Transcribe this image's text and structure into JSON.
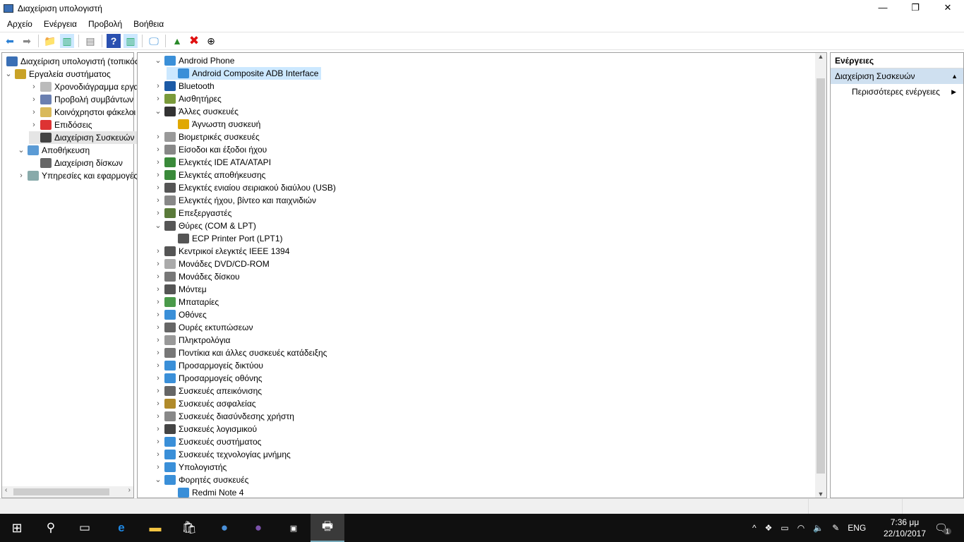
{
  "window": {
    "title": "Διαχείριση υπολογιστή",
    "minimize": "—",
    "maximize": "❐",
    "close": "✕"
  },
  "menu": [
    "Αρχείο",
    "Ενέργεια",
    "Προβολή",
    "Βοήθεια"
  ],
  "left_tree": [
    {
      "label": "Διαχείριση υπολογιστή (τοπικός)",
      "level": 0,
      "chev": "",
      "color": "#3a6fb5"
    },
    {
      "label": "Εργαλεία συστήματος",
      "level": 0,
      "chev": "⌄",
      "color": "#c9a227",
      "indent": 1
    },
    {
      "label": "Χρονοδιάγραμμα εργασιών",
      "level": 2,
      "chev": "›",
      "color": "#bbb"
    },
    {
      "label": "Προβολή συμβάντων",
      "level": 2,
      "chev": "›",
      "color": "#6a7fb0"
    },
    {
      "label": "Κοινόχρηστοι φάκελοι",
      "level": 2,
      "chev": "›",
      "color": "#d9b95a"
    },
    {
      "label": "Επιδόσεις",
      "level": 2,
      "chev": "›",
      "color": "#d33"
    },
    {
      "label": "Διαχείριση Συσκευών",
      "level": 2,
      "chev": "",
      "color": "#444",
      "selected": true
    },
    {
      "label": "Αποθήκευση",
      "level": 1,
      "chev": "⌄",
      "color": "#5b9bd5"
    },
    {
      "label": "Διαχείριση δίσκων",
      "level": 2,
      "chev": "",
      "color": "#666"
    },
    {
      "label": "Υπηρεσίες και εφαρμογές",
      "level": 1,
      "chev": "›",
      "color": "#8aa"
    }
  ],
  "devices": [
    {
      "label": "Android Phone",
      "level": 0,
      "chev": "⌄",
      "color": "#3a8fd8"
    },
    {
      "label": "Android Composite ADB Interface",
      "level": 1,
      "chev": "",
      "color": "#3a8fd8",
      "selected": true
    },
    {
      "label": "Bluetooth",
      "level": 0,
      "chev": "›",
      "color": "#1c5aa6"
    },
    {
      "label": "Αισθητήρες",
      "level": 0,
      "chev": "›",
      "color": "#7a9a3a"
    },
    {
      "label": "Άλλες συσκευές",
      "level": 0,
      "chev": "⌄",
      "color": "#333"
    },
    {
      "label": "Άγνωστη συσκευή",
      "level": 1,
      "chev": "",
      "color": "#e0a800"
    },
    {
      "label": "Βιομετρικές συσκευές",
      "level": 0,
      "chev": "›",
      "color": "#999"
    },
    {
      "label": "Είσοδοι και έξοδοι ήχου",
      "level": 0,
      "chev": "›",
      "color": "#888"
    },
    {
      "label": "Ελεγκτές IDE ATA/ATAPI",
      "level": 0,
      "chev": "›",
      "color": "#3a8a3a"
    },
    {
      "label": "Ελεγκτές αποθήκευσης",
      "level": 0,
      "chev": "›",
      "color": "#3a8a3a"
    },
    {
      "label": "Ελεγκτές ενιαίου σειριακού διαύλου (USB)",
      "level": 0,
      "chev": "›",
      "color": "#555"
    },
    {
      "label": "Ελεγκτές ήχου, βίντεο και παιχνιδιών",
      "level": 0,
      "chev": "›",
      "color": "#888"
    },
    {
      "label": "Επεξεργαστές",
      "level": 0,
      "chev": "›",
      "color": "#5a7a3a"
    },
    {
      "label": "Θύρες (COM & LPT)",
      "level": 0,
      "chev": "⌄",
      "color": "#555"
    },
    {
      "label": "ECP Printer Port (LPT1)",
      "level": 1,
      "chev": "",
      "color": "#555"
    },
    {
      "label": "Κεντρικοί ελεγκτές IEEE 1394",
      "level": 0,
      "chev": "›",
      "color": "#555"
    },
    {
      "label": "Μονάδες DVD/CD-ROM",
      "level": 0,
      "chev": "›",
      "color": "#aaa"
    },
    {
      "label": "Μονάδες δίσκου",
      "level": 0,
      "chev": "›",
      "color": "#777"
    },
    {
      "label": "Μόντεμ",
      "level": 0,
      "chev": "›",
      "color": "#555"
    },
    {
      "label": "Μπαταρίες",
      "level": 0,
      "chev": "›",
      "color": "#4a9a4a"
    },
    {
      "label": "Οθόνες",
      "level": 0,
      "chev": "›",
      "color": "#3a8fd8"
    },
    {
      "label": "Ουρές εκτυπώσεων",
      "level": 0,
      "chev": "›",
      "color": "#666"
    },
    {
      "label": "Πληκτρολόγια",
      "level": 0,
      "chev": "›",
      "color": "#999"
    },
    {
      "label": "Ποντίκια και άλλες συσκευές κατάδειξης",
      "level": 0,
      "chev": "›",
      "color": "#777"
    },
    {
      "label": "Προσαρμογείς δικτύου",
      "level": 0,
      "chev": "›",
      "color": "#3a8fd8"
    },
    {
      "label": "Προσαρμογείς οθόνης",
      "level": 0,
      "chev": "›",
      "color": "#3a8fd8"
    },
    {
      "label": "Συσκευές απεικόνισης",
      "level": 0,
      "chev": "›",
      "color": "#666"
    },
    {
      "label": "Συσκευές ασφαλείας",
      "level": 0,
      "chev": "›",
      "color": "#b08a2a"
    },
    {
      "label": "Συσκευές διασύνδεσης χρήστη",
      "level": 0,
      "chev": "›",
      "color": "#888"
    },
    {
      "label": "Συσκευές λογισμικού",
      "level": 0,
      "chev": "›",
      "color": "#444"
    },
    {
      "label": "Συσκευές συστήματος",
      "level": 0,
      "chev": "›",
      "color": "#3a8fd8"
    },
    {
      "label": "Συσκευές τεχνολογίας μνήμης",
      "level": 0,
      "chev": "›",
      "color": "#3a8fd8"
    },
    {
      "label": "Υπολογιστής",
      "level": 0,
      "chev": "›",
      "color": "#3a8fd8"
    },
    {
      "label": "Φορητές συσκευές",
      "level": 0,
      "chev": "⌄",
      "color": "#3a8fd8"
    },
    {
      "label": "Redmi Note 4",
      "level": 1,
      "chev": "",
      "color": "#3a8fd8"
    }
  ],
  "actions": {
    "header": "Ενέργειες",
    "section": "Διαχείριση Συσκευών",
    "more": "Περισσότερες ενέργειες"
  },
  "taskbar": {
    "lang": "ENG",
    "time": "7:36 μμ",
    "date": "22/10/2017",
    "notifications": "1"
  }
}
